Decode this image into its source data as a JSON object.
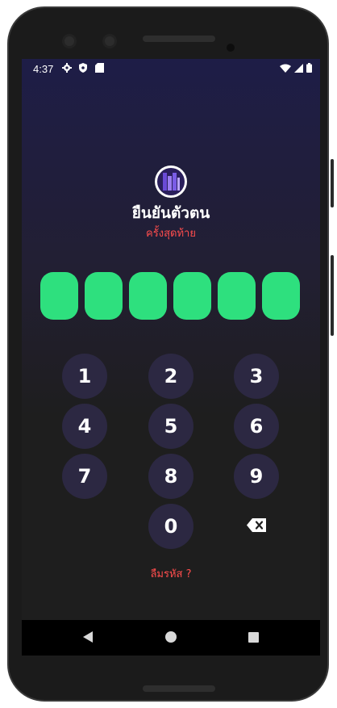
{
  "status_bar": {
    "time": "4:37",
    "icons_left": [
      "gear-icon",
      "shield-icon",
      "sd-card-icon"
    ],
    "icons_right": [
      "wifi-icon",
      "signal-icon",
      "battery-icon"
    ]
  },
  "header": {
    "title": "ยืนยันตัวตน",
    "subtitle": "ครั้งสุดท้าย"
  },
  "pin": {
    "length": 6,
    "filled": 6,
    "fill_color": "#2ee07e"
  },
  "keypad": {
    "keys": [
      "1",
      "2",
      "3",
      "4",
      "5",
      "6",
      "7",
      "8",
      "9",
      "0"
    ],
    "backspace_icon": "backspace-icon"
  },
  "forgot_link": "ลืมรหัส ?",
  "colors": {
    "accent_red": "#ff4d4d",
    "key_bg": "#2c2842",
    "pin_green": "#2ee07e"
  }
}
